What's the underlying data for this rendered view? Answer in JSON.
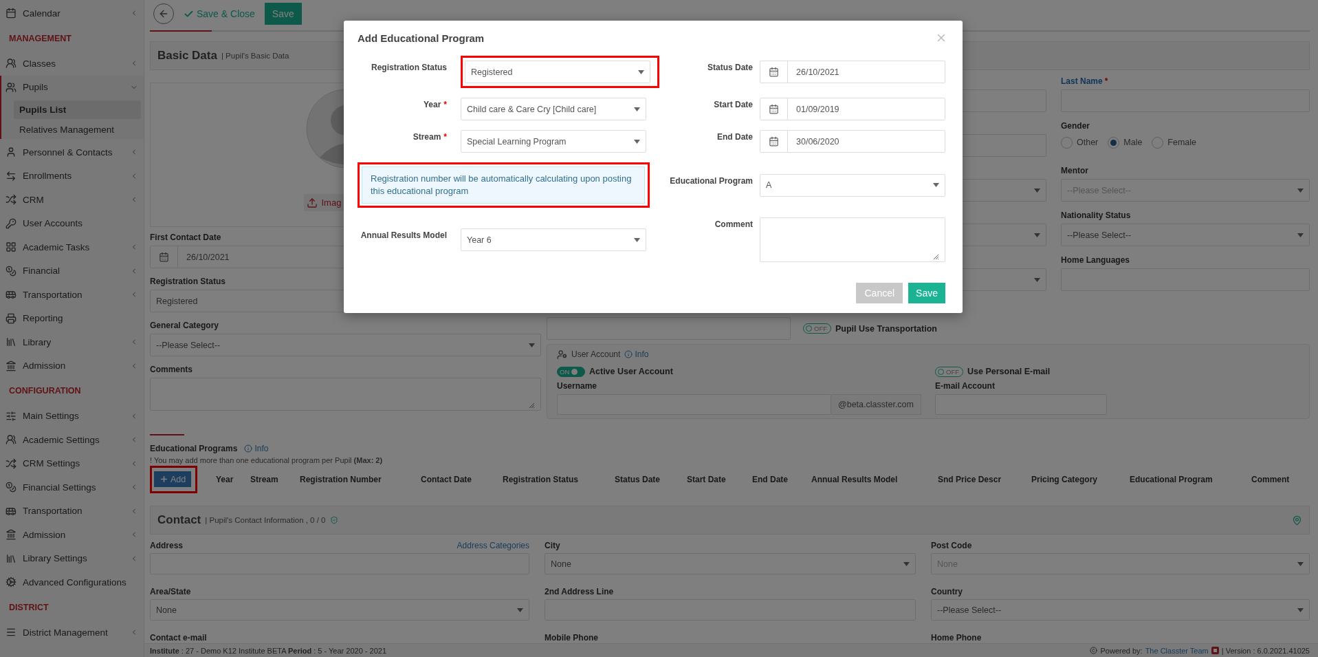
{
  "sidebar": {
    "items": [
      {
        "kind": "item",
        "label": "Calendar",
        "has_submenu": true
      },
      {
        "kind": "section",
        "label": "MANAGEMENT"
      },
      {
        "kind": "item",
        "label": "Classes",
        "has_submenu": true
      },
      {
        "kind": "item",
        "label": "Pupils",
        "has_submenu": true,
        "expanded": true,
        "children": [
          {
            "label": "Pupils List",
            "selected": true
          },
          {
            "label": "Relatives Management",
            "selected": false
          }
        ]
      },
      {
        "kind": "item",
        "label": "Personnel & Contacts",
        "has_submenu": true
      },
      {
        "kind": "item",
        "label": "Enrollments",
        "has_submenu": true
      },
      {
        "kind": "item",
        "label": "CRM",
        "has_submenu": true
      },
      {
        "kind": "item",
        "label": "User Accounts",
        "has_submenu": false
      },
      {
        "kind": "item",
        "label": "Academic Tasks",
        "has_submenu": true
      },
      {
        "kind": "item",
        "label": "Financial",
        "has_submenu": true
      },
      {
        "kind": "item",
        "label": "Transportation",
        "has_submenu": true
      },
      {
        "kind": "item",
        "label": "Reporting",
        "has_submenu": false
      },
      {
        "kind": "item",
        "label": "Library",
        "has_submenu": true
      },
      {
        "kind": "item",
        "label": "Admission",
        "has_submenu": true
      },
      {
        "kind": "section",
        "label": "CONFIGURATION"
      },
      {
        "kind": "item",
        "label": "Main Settings",
        "has_submenu": true
      },
      {
        "kind": "item",
        "label": "Academic Settings",
        "has_submenu": true
      },
      {
        "kind": "item",
        "label": "CRM Settings",
        "has_submenu": true
      },
      {
        "kind": "item",
        "label": "Financial Settings",
        "has_submenu": true
      },
      {
        "kind": "item",
        "label": "Transportation",
        "has_submenu": true
      },
      {
        "kind": "item",
        "label": "Admission",
        "has_submenu": true
      },
      {
        "kind": "item",
        "label": "Library Settings",
        "has_submenu": true
      },
      {
        "kind": "item",
        "label": "Advanced Configurations",
        "has_submenu": false
      },
      {
        "kind": "section",
        "label": "DISTRICT"
      },
      {
        "kind": "item",
        "label": "District Management",
        "has_submenu": true
      }
    ]
  },
  "toolbar": {
    "buttons": [
      {
        "kind": "back"
      },
      {
        "kind": "link",
        "label": "Save & Close"
      },
      {
        "kind": "primary",
        "label": "Save"
      }
    ]
  },
  "basic_data": {
    "title": "Basic Data",
    "subtitle": "| Pupil's Basic Data",
    "photo": {
      "upload_label": "Imag"
    },
    "left_fields": [
      {
        "kind": "date",
        "label": "First Contact Date",
        "value": "26/10/2021"
      },
      {
        "kind": "text",
        "label": "Registration Status",
        "value": "Registered"
      },
      {
        "kind": "select",
        "label": "General Category",
        "placeholder": "--Please Select--",
        "disabled": false
      },
      {
        "kind": "textarea",
        "label": "Comments"
      }
    ],
    "middle_fields": [
      {
        "kind": "text"
      },
      {
        "kind": "text"
      },
      {
        "kind": "select"
      },
      {
        "kind": "select"
      },
      {
        "kind": "select"
      }
    ],
    "right_fields": [
      {
        "kind": "text",
        "label": "Last Name",
        "required_mark": "*",
        "highlight": true
      },
      {
        "kind": "radio",
        "label": "Gender",
        "options": [
          {
            "label": "Other",
            "selected": false
          },
          {
            "label": "Male",
            "selected": true
          },
          {
            "label": "Female",
            "selected": false
          }
        ]
      },
      {
        "kind": "select",
        "label": "Mentor",
        "placeholder": "--Please Select--",
        "disabled": true
      },
      {
        "kind": "select",
        "label": "Nationality Status",
        "placeholder": "--Please Select--",
        "disabled": false
      },
      {
        "kind": "text",
        "label": "Home Languages"
      }
    ],
    "transport_toggle": {
      "label": "Pupil Use Transportation",
      "on": false,
      "state_text": "OFF"
    },
    "user_account": {
      "title": "User Account",
      "info": "Info",
      "active_toggle": {
        "label": "Active User Account",
        "on": true,
        "state_text": "ON"
      },
      "username": {
        "label": "Username",
        "suffix": "@beta.classter.com"
      },
      "email_toggle": {
        "label": "Use Personal E-mail",
        "on": false,
        "state_text": "OFF"
      },
      "email": {
        "label": "E-mail Account"
      }
    }
  },
  "educational_programs": {
    "title": "Educational Programs",
    "info": "Info",
    "note": "! You may add more than one educational program per Pupil **(Max: 2)**",
    "add_label": "Add",
    "add_highlighted": true,
    "columns": [
      "Year",
      "Stream",
      "Registration Number",
      "Contact Date",
      "Registration Status",
      "Status Date",
      "Start Date",
      "End Date",
      "Annual Results Model",
      "Snd Price Descr",
      "Pricing Category",
      "Educational Program",
      "Comment"
    ]
  },
  "contact": {
    "title": "Contact",
    "subtitle": "| Pupil's Contact Information , 0 / 0",
    "fields": [
      {
        "kind": "text",
        "label": "Address",
        "link": "Address Categories"
      },
      {
        "kind": "select",
        "label": "City",
        "value": "None",
        "disabled": false
      },
      {
        "kind": "select",
        "label": "Post Code",
        "value": "None",
        "disabled": true
      },
      {
        "kind": "select",
        "label": "Area/State",
        "value": "None",
        "disabled": false
      },
      {
        "kind": "text",
        "label": "2nd Address Line"
      },
      {
        "kind": "select",
        "label": "Country",
        "placeholder": "--Please Select--",
        "disabled": false
      },
      {
        "kind": "label_only",
        "label": "Contact e-mail"
      },
      {
        "kind": "label_only",
        "label": "Mobile Phone"
      },
      {
        "kind": "label_only",
        "label": "Home Phone"
      }
    ]
  },
  "footer": {
    "institute": "**Institute** : 27 - Demo K12 Institute BETA **Period** : 5 - Year 2020 - 2021",
    "powered_by": "Powered by:",
    "team": "The Classter Team",
    "version": "| Version : 6.0.2021.41025"
  },
  "modal": {
    "title": "Add Educational Program",
    "left_fields": [
      {
        "kind": "select",
        "label": "Registration Status",
        "value": "Registered",
        "highlighted": true
      },
      {
        "kind": "select",
        "label": "Year",
        "value": "Child care & Care Cry [Child care]",
        "required_mark": "*",
        "highlighted": false
      },
      {
        "kind": "select",
        "label": "Stream",
        "value": "Special Learning Program",
        "required_mark": "*",
        "highlighted": false
      },
      {
        "kind": "notice",
        "text": "Registration number will be automatically calculating upon posting this educational program",
        "highlighted": true
      },
      {
        "kind": "select",
        "label": "Annual Results Model",
        "value": "Year 6",
        "highlighted": false
      }
    ],
    "right_fields": [
      {
        "kind": "date",
        "label": "Status Date",
        "value": "26/10/2021"
      },
      {
        "kind": "date",
        "label": "Start Date",
        "value": "01/09/2019"
      },
      {
        "kind": "date",
        "label": "End Date",
        "value": "30/06/2020"
      },
      {
        "kind": "select",
        "label": "Educational Program",
        "value": "A"
      },
      {
        "kind": "textarea",
        "label": "Comment"
      }
    ],
    "buttons": [
      {
        "kind": "secondary",
        "label": "Cancel"
      },
      {
        "kind": "primary",
        "label": "Save"
      }
    ]
  }
}
